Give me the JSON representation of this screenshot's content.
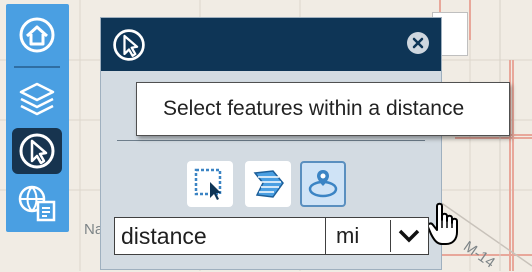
{
  "map": {
    "label_left": "Naga",
    "label_right": "M-14"
  },
  "toolbar": {
    "items": [
      {
        "name": "home",
        "icon": "home-globe-icon",
        "active": false
      },
      {
        "name": "layers",
        "icon": "layers-icon",
        "active": false
      },
      {
        "name": "select",
        "icon": "select-cursor-icon",
        "active": true
      },
      {
        "name": "print",
        "icon": "map-document-icon",
        "active": false
      }
    ]
  },
  "panel": {
    "header_icon": "select-cursor-icon",
    "close_icon": "close-icon",
    "tools": [
      {
        "name": "select-rectangle",
        "icon": "rectangle-select-icon",
        "active": false
      },
      {
        "name": "select-polygon",
        "icon": "polygon-select-icon",
        "active": false
      },
      {
        "name": "select-distance",
        "icon": "distance-select-icon",
        "active": true
      }
    ],
    "distance_input": {
      "value": "distance"
    },
    "unit_select": {
      "value": "mi"
    }
  },
  "tooltip": {
    "text": "Select features within a distance"
  },
  "colors": {
    "toolbar_bg": "#4a9fe2",
    "toolbar_active": "#17344f",
    "panel_header": "#0e3556",
    "panel_body": "#d3dbe2",
    "map_bg": "#f1ece4",
    "parcel_line": "#e8a79a"
  }
}
